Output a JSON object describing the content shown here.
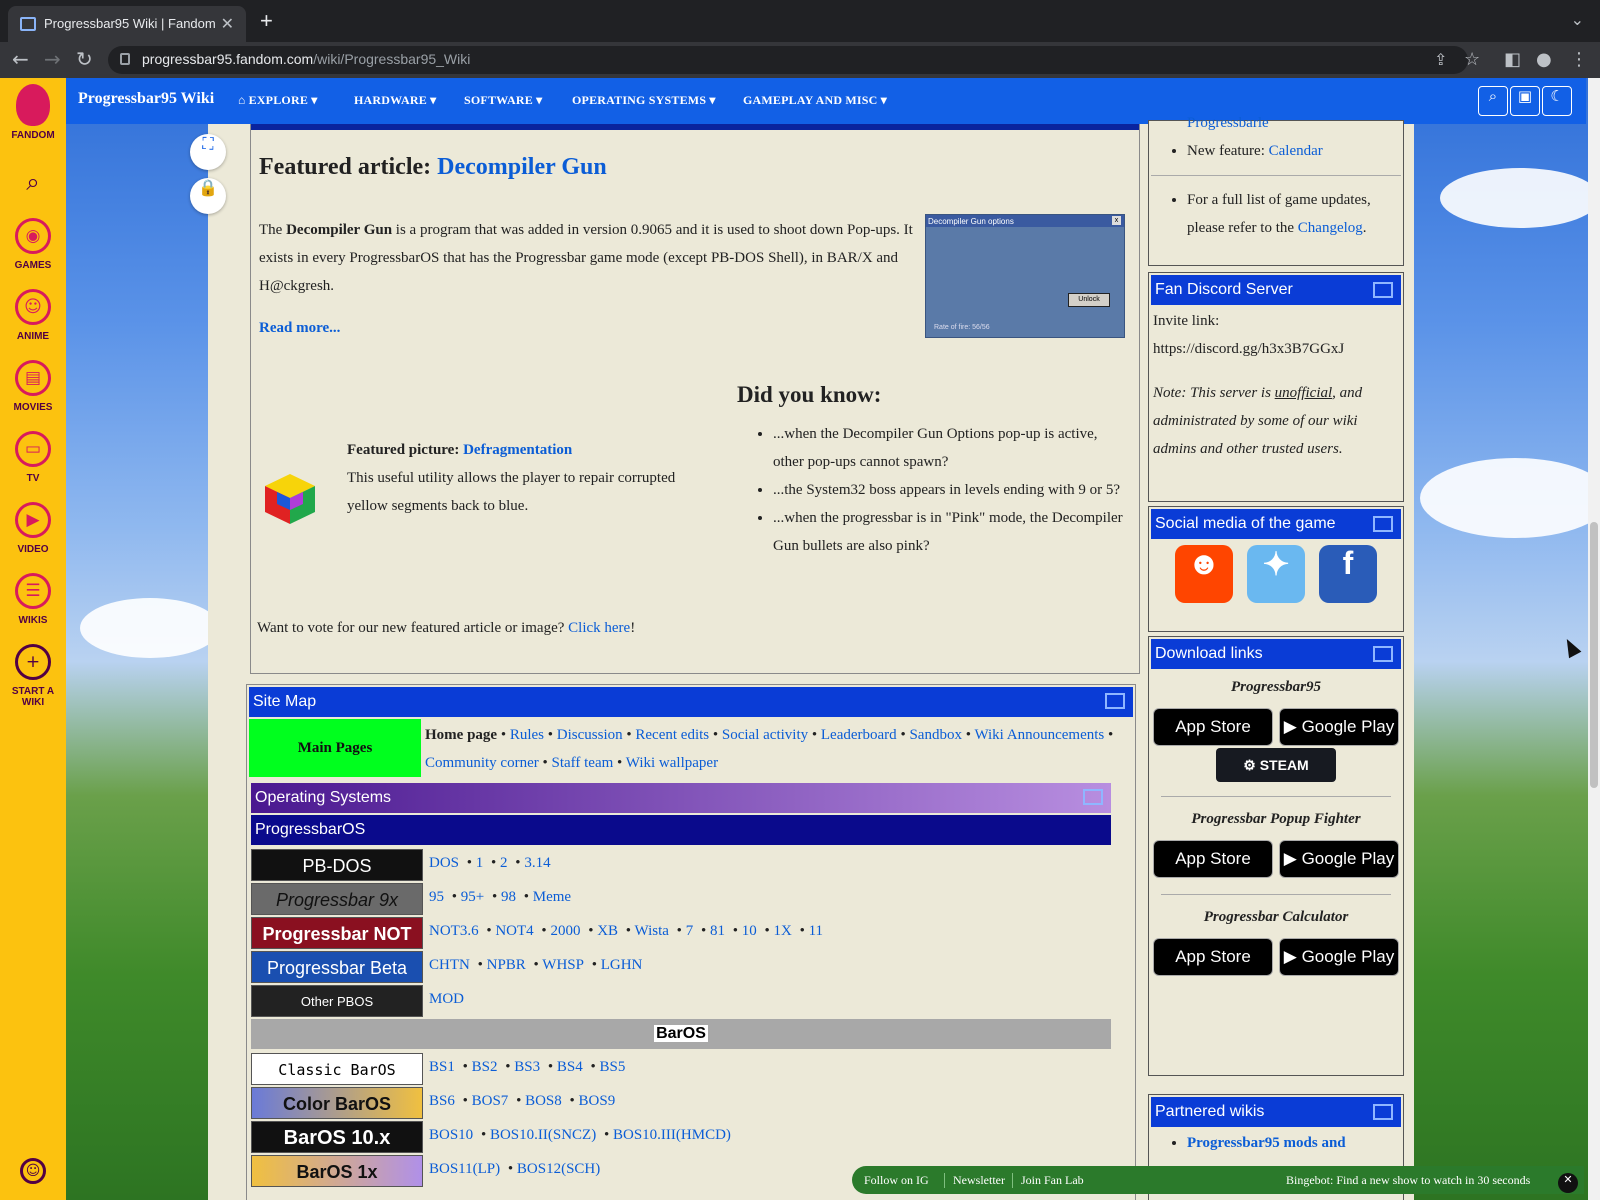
{
  "browser": {
    "tab_title": "Progressbar95 Wiki | Fandom",
    "url_domain": "progressbar95.fandom.com",
    "url_path": "/wiki/Progressbar95_Wiki"
  },
  "rail": {
    "brand": "FANDOM",
    "items": [
      {
        "label": "GAMES",
        "icon": "gamepad-icon"
      },
      {
        "label": "ANIME",
        "icon": "anime-face-icon"
      },
      {
        "label": "MOVIES",
        "icon": "film-icon"
      },
      {
        "label": "TV",
        "icon": "tv-icon"
      },
      {
        "label": "VIDEO",
        "icon": "play-icon"
      },
      {
        "label": "WIKIS",
        "icon": "book-icon"
      },
      {
        "label": "START A WIKI",
        "icon": "plus-icon"
      }
    ]
  },
  "wikinav": {
    "title": "Progressbar95 Wiki",
    "items": [
      "EXPLORE",
      "HARDWARE",
      "SOFTWARE",
      "OPERATING SYSTEMS",
      "GAMEPLAY AND MISC"
    ]
  },
  "featured": {
    "heading": "Featured article: ",
    "link": "Decompiler Gun",
    "body_pre": "The ",
    "body_bold": "Decompiler Gun",
    "body_post": " is a program that was added in version 0.9065 and it is used to shoot down Pop-ups. It exists in every ProgressbarOS that has the Progressbar game mode (except PB-DOS Shell), in BAR/X and H@ckgresh.",
    "read_more": "Read more...",
    "screenshot": {
      "title": "Decompiler Gun options",
      "button": "Unlock",
      "rate": "Rate of fire: 56/56"
    }
  },
  "picture": {
    "label": "Featured picture: ",
    "link": "Defragmentation",
    "text": "This useful utility allows the player to repair corrupted yellow segments back to blue."
  },
  "dyk": {
    "heading": "Did you know:",
    "items": [
      "...when the Decompiler Gun Options pop-up is active, other pop-ups cannot spawn?",
      "...the System32 boss appears in levels ending with 9 or 5?",
      "...when the progressbar is in \"Pink\" mode, the Decompiler Gun bullets are also pink?"
    ]
  },
  "vote": {
    "text": "Want to vote for our new featured article or image? ",
    "link": "Click here",
    "tail": "!"
  },
  "sitemap": {
    "title": "Site Map",
    "main_pages": "Main Pages",
    "home": "Home page",
    "links": [
      "Rules",
      "Discussion",
      "Recent edits",
      "Social activity",
      "Leaderboard",
      "Sandbox",
      "Wiki Announcements",
      "Community corner",
      "Staff team",
      "Wiki wallpaper"
    ],
    "os_title": "Operating Systems",
    "pbos_title": "ProgressbarOS",
    "bar_os_title": "BarOS",
    "rows": [
      {
        "banner": "PB-DOS",
        "links": [
          "DOS",
          "1",
          "2",
          "3.14"
        ]
      },
      {
        "banner": "Progressbar 9x",
        "links": [
          "95",
          "95+",
          "98",
          "Meme"
        ]
      },
      {
        "banner": "Progressbar NOT",
        "links": [
          "NOT3.6",
          "NOT4",
          "2000",
          "XB",
          "Wista",
          "7",
          "81",
          "10",
          "1X",
          "11"
        ]
      },
      {
        "banner": "Progressbar Beta",
        "links": [
          "CHTN",
          "NPBR",
          "WHSP",
          "LGHN"
        ]
      },
      {
        "banner": "Other PBOS",
        "links": [
          "MOD"
        ]
      }
    ],
    "bar_rows": [
      {
        "banner": "Classic BarOS",
        "links": [
          "BS1",
          "BS2",
          "BS3",
          "BS4",
          "BS5"
        ]
      },
      {
        "banner": "Color BarOS",
        "links": [
          "BS6",
          "BOS7",
          "BOS8",
          "BOS9"
        ]
      },
      {
        "banner": "BarOS 10.x",
        "links": [
          "BOS10",
          "BOS10.II(SNCZ)",
          "BOS10.III(HMCD)"
        ]
      },
      {
        "banner": "BarOS 1x",
        "links": [
          "BOS11(LP)",
          "BOS12(SCH)"
        ]
      }
    ]
  },
  "sidebar": {
    "updates_cut": "Progressbarle",
    "new_feature_label": "New feature: ",
    "new_feature_link": "Calendar",
    "full_list": "For a full list of game updates, please refer to the ",
    "changelog": "Changelog",
    "discord_title": "Fan Discord Server",
    "invite_label": "Invite link:",
    "invite_link": "https://discord.gg/h3x3B7GGxJ",
    "note_pre": "Note: This server is ",
    "note_u": "unofficial",
    "note_post": ", and administrated by some of our wiki admins and other trusted users.",
    "social_title": "Social media of the game",
    "download_title": "Download links",
    "games": [
      "Progressbar95",
      "Progressbar Popup Fighter",
      "Progressbar Calculator"
    ],
    "app_store": "App Store",
    "google_play": "Google Play",
    "steam": "STEAM",
    "partnered_title": "Partnered wikis",
    "partnered_first": "Progressbar95 mods and"
  },
  "bottombar": {
    "links": [
      "Follow on IG",
      "Newsletter",
      "Join Fan Lab"
    ],
    "bingebot": "Bingebot: Find a new show to watch in 30 seconds"
  }
}
